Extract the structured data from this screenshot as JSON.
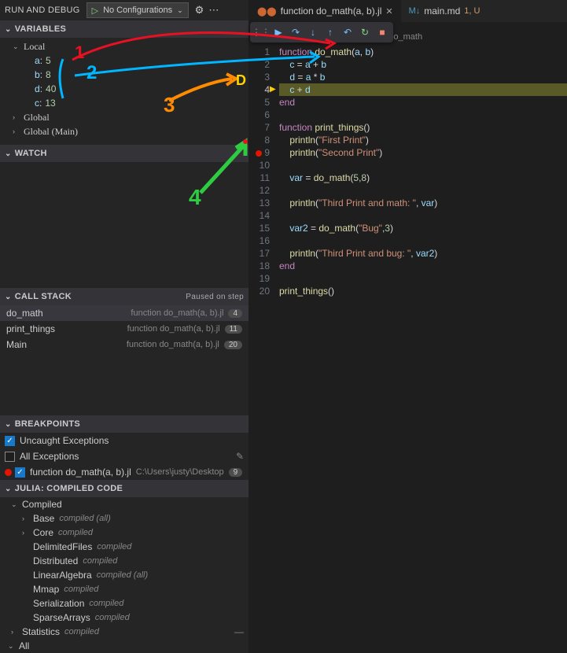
{
  "topbar": {
    "title": "RUN AND DEBUG",
    "config": "No Configurations"
  },
  "variables": {
    "header": "VARIABLES",
    "local_label": "Local",
    "vars": [
      {
        "name": "a",
        "val": "5"
      },
      {
        "name": "b",
        "val": "8"
      },
      {
        "name": "d",
        "val": "40"
      },
      {
        "name": "c",
        "val": "13"
      }
    ],
    "global_label": "Global",
    "global_main_label": "Global (Main)"
  },
  "watch": {
    "header": "WATCH"
  },
  "callstack": {
    "header": "CALL STACK",
    "status": "Paused on step",
    "frames": [
      {
        "name": "do_math",
        "src": "function do_math(a, b).jl",
        "line": "4"
      },
      {
        "name": "print_things",
        "src": "function do_math(a, b).jl",
        "line": "11"
      },
      {
        "name": "Main",
        "src": "function do_math(a, b).jl",
        "line": "20"
      }
    ]
  },
  "breakpoints": {
    "header": "BREAKPOINTS",
    "uncaught": "Uncaught Exceptions",
    "all": "All Exceptions",
    "file_bp": "function do_math(a, b).jl",
    "file_path": "C:\\Users\\justy\\Desktop",
    "file_line": "9"
  },
  "compiled": {
    "header": "JULIA: COMPILED CODE",
    "root": "Compiled",
    "items": [
      {
        "name": "Base",
        "tag": "compiled (all)"
      },
      {
        "name": "Core",
        "tag": "compiled"
      },
      {
        "name": "DelimitedFiles",
        "tag": "compiled"
      },
      {
        "name": "Distributed",
        "tag": "compiled"
      },
      {
        "name": "LinearAlgebra",
        "tag": "compiled (all)"
      },
      {
        "name": "Mmap",
        "tag": "compiled"
      },
      {
        "name": "Serialization",
        "tag": "compiled"
      },
      {
        "name": "SparseArrays",
        "tag": "compiled"
      }
    ],
    "statistics": "Statistics",
    "statistics_tag": "compiled",
    "all": "All"
  },
  "tabs": {
    "t1": "function do_math(a, b).jl",
    "t2": "main.md",
    "t2_badges": "1, U"
  },
  "breadcrumb": {
    "file": "function do_math(a, b).jl",
    "symbol": "do_math"
  },
  "code": {
    "lines": [
      [
        {
          "t": "function ",
          "c": "kw"
        },
        {
          "t": "do_math",
          "c": "fn"
        },
        {
          "t": "(",
          "c": "pn"
        },
        {
          "t": "a",
          "c": "id"
        },
        {
          "t": ", ",
          "c": "pn"
        },
        {
          "t": "b",
          "c": "id"
        },
        {
          "t": ")",
          "c": "pn"
        }
      ],
      [
        {
          "t": "    c ",
          "c": "id"
        },
        {
          "t": "= ",
          "c": "op"
        },
        {
          "t": "a ",
          "c": "id"
        },
        {
          "t": "+ ",
          "c": "op"
        },
        {
          "t": "b",
          "c": "id"
        }
      ],
      [
        {
          "t": "    d ",
          "c": "id"
        },
        {
          "t": "= ",
          "c": "op"
        },
        {
          "t": "a ",
          "c": "id"
        },
        {
          "t": "* ",
          "c": "op"
        },
        {
          "t": "b",
          "c": "id"
        }
      ],
      [
        {
          "t": "    c ",
          "c": "id"
        },
        {
          "t": "+ ",
          "c": "op"
        },
        {
          "t": "d",
          "c": "id"
        }
      ],
      [
        {
          "t": "end",
          "c": "kw"
        }
      ],
      [],
      [
        {
          "t": "function ",
          "c": "kw"
        },
        {
          "t": "print_things",
          "c": "fn"
        },
        {
          "t": "()",
          "c": "pn"
        }
      ],
      [
        {
          "t": "    ",
          "c": "pn"
        },
        {
          "t": "println",
          "c": "fn"
        },
        {
          "t": "(",
          "c": "pn"
        },
        {
          "t": "\"First Print\"",
          "c": "str"
        },
        {
          "t": ")",
          "c": "pn"
        }
      ],
      [
        {
          "t": "    ",
          "c": "pn"
        },
        {
          "t": "println",
          "c": "fn"
        },
        {
          "t": "(",
          "c": "pn"
        },
        {
          "t": "\"Second Print\"",
          "c": "str"
        },
        {
          "t": ")",
          "c": "pn"
        }
      ],
      [],
      [
        {
          "t": "    var ",
          "c": "id"
        },
        {
          "t": "= ",
          "c": "op"
        },
        {
          "t": "do_math",
          "c": "fn"
        },
        {
          "t": "(",
          "c": "pn"
        },
        {
          "t": "5",
          "c": "num"
        },
        {
          "t": ",",
          "c": "pn"
        },
        {
          "t": "8",
          "c": "num"
        },
        {
          "t": ")",
          "c": "pn"
        }
      ],
      [],
      [
        {
          "t": "    ",
          "c": "pn"
        },
        {
          "t": "println",
          "c": "fn"
        },
        {
          "t": "(",
          "c": "pn"
        },
        {
          "t": "\"Third Print and math: \"",
          "c": "str"
        },
        {
          "t": ", ",
          "c": "pn"
        },
        {
          "t": "var",
          "c": "id"
        },
        {
          "t": ")",
          "c": "pn"
        }
      ],
      [],
      [
        {
          "t": "    var2 ",
          "c": "id"
        },
        {
          "t": "= ",
          "c": "op"
        },
        {
          "t": "do_math",
          "c": "fn"
        },
        {
          "t": "(",
          "c": "pn"
        },
        {
          "t": "\"Bug\"",
          "c": "str"
        },
        {
          "t": ",",
          "c": "pn"
        },
        {
          "t": "3",
          "c": "num"
        },
        {
          "t": ")",
          "c": "pn"
        }
      ],
      [],
      [
        {
          "t": "    ",
          "c": "pn"
        },
        {
          "t": "println",
          "c": "fn"
        },
        {
          "t": "(",
          "c": "pn"
        },
        {
          "t": "\"Third Print and bug: \"",
          "c": "str"
        },
        {
          "t": ", ",
          "c": "pn"
        },
        {
          "t": "var2",
          "c": "id"
        },
        {
          "t": ")",
          "c": "pn"
        }
      ],
      [
        {
          "t": "end",
          "c": "kw"
        }
      ],
      [],
      [
        {
          "t": "print_things",
          "c": "fn"
        },
        {
          "t": "()",
          "c": "pn"
        }
      ]
    ],
    "current": 4,
    "breakpoint_line": 9
  },
  "annot": {
    "n1": "1",
    "n2": "2",
    "n3": "3",
    "n4": "4",
    "d": "D"
  }
}
